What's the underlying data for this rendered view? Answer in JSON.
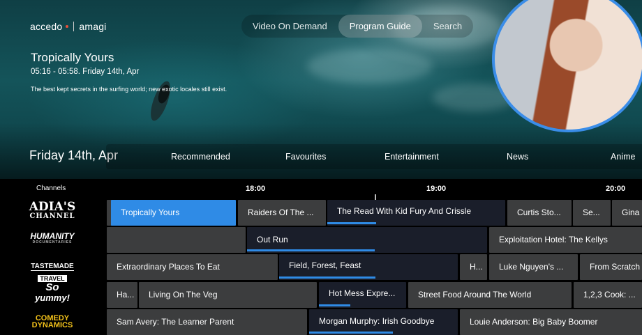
{
  "brand": {
    "left": "accedo",
    "right": "amagi"
  },
  "nav": {
    "tabs": [
      "Video On Demand",
      "Program Guide",
      "Search"
    ],
    "active": 1
  },
  "featured": {
    "title": "Tropically Yours",
    "time": "05:16 - 05:58. Friday 14th, Apr",
    "description": "The best kept secrets in the surfing world; new exotic locales still exist."
  },
  "date_label": "Friday 14th, Apr",
  "categories": [
    "Recommended",
    "Favourites",
    "Entertainment",
    "News",
    "Anime"
  ],
  "guide": {
    "channels_header": "Channels",
    "times": [
      "18:00",
      "19:00",
      "20:00"
    ],
    "channels": [
      {
        "name": "ADIA'S CHANNEL",
        "line1": "ADIA'S",
        "line2": "CHANNEL"
      },
      {
        "name": "HUMANITY DOCUMENTARIES",
        "line1": "HUMANITY",
        "line2": "DOCUMENTARIES"
      },
      {
        "name": "TASTEMADE TRAVEL",
        "line1": "TASTEMADE",
        "line2": "TRAVEL"
      },
      {
        "name": "So Yummy!",
        "line1": "So",
        "line2": "yummy!"
      },
      {
        "name": "COMEDY DYNAMICS",
        "line1": "COMEDY",
        "line2": "DYNAMICS"
      }
    ],
    "rows": [
      [
        "Tropically Yours",
        "Raiders Of The ...",
        "The Read With Kid Fury And Crissle",
        "Curtis Sto...",
        "Se...",
        "Gina"
      ],
      [
        "",
        "Out Run",
        "Exploitation Hotel: The Kellys"
      ],
      [
        "Extraordinary Places To Eat",
        "Field, Forest, Feast",
        "H...",
        "Luke Nguyen's ...",
        "From Scratch"
      ],
      [
        "Ha...",
        "Living On The Veg",
        "Hot Mess Expre...",
        "Street Food Around The World",
        "1,2,3 Cook: ..."
      ],
      [
        "Sam Avery: The Learner Parent",
        "Morgan Murphy: Irish Goodbye",
        "Louie Anderson: Big Baby Boomer"
      ]
    ]
  },
  "colors": {
    "accent": "#2f8be6",
    "avatar_ring": "#3a8de8",
    "cell": "#3c3d3e",
    "live_cell": "#1a1e2a"
  }
}
